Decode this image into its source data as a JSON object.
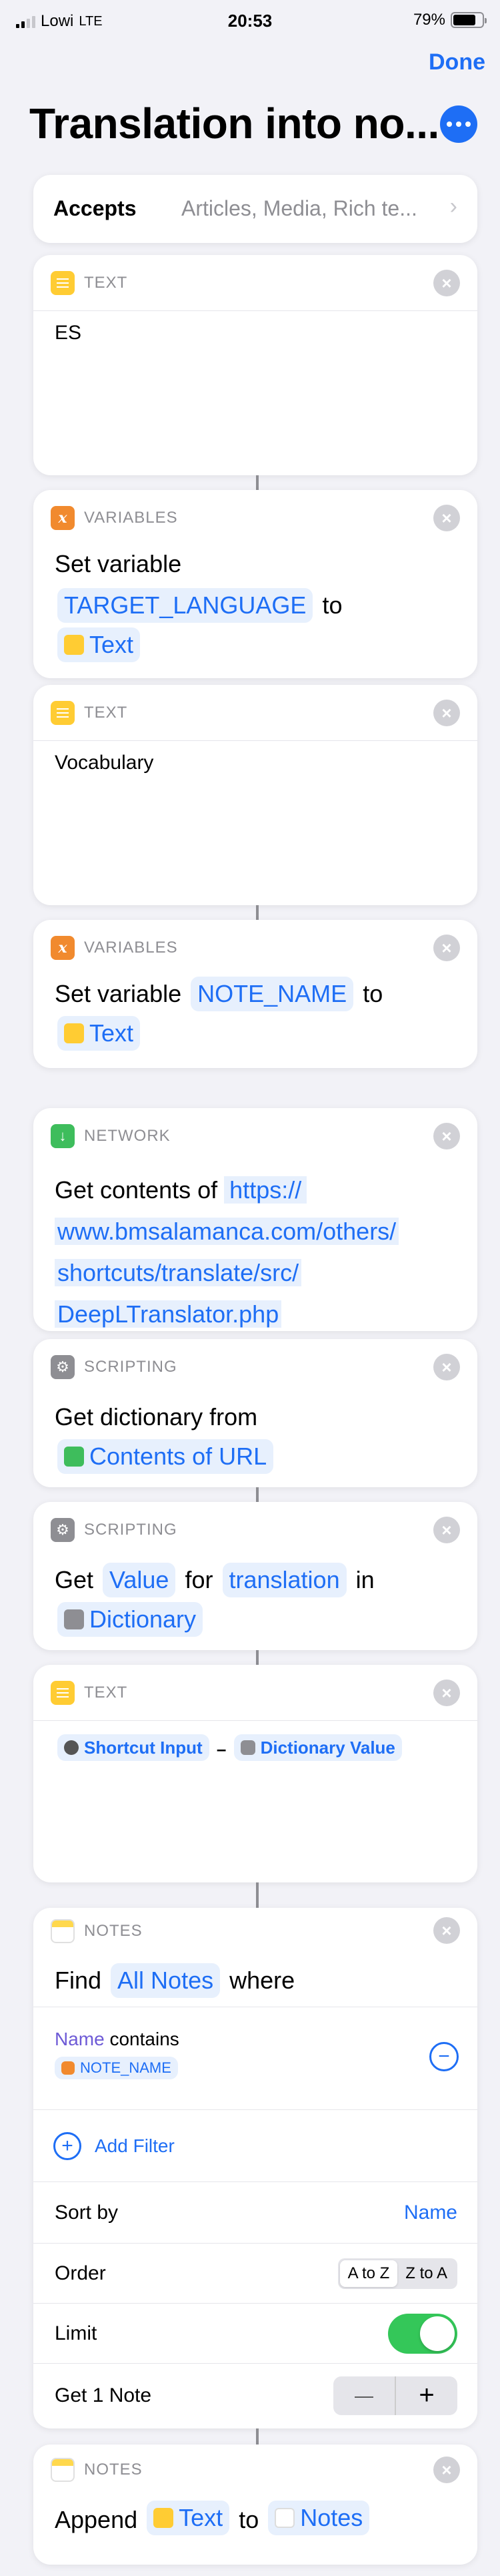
{
  "status": {
    "carrier": "Lowi",
    "network": "LTE",
    "time": "20:53",
    "battery": "79%",
    "battery_level": 0.79
  },
  "header": {
    "done_label": "Done",
    "title": "Translation into no..."
  },
  "accepts": {
    "label": "Accepts",
    "value": "Articles, Media, Rich te..."
  },
  "actions": [
    {
      "category": "TEXT",
      "text": "ES"
    },
    {
      "category": "VARIABLES",
      "prefix": "Set variable",
      "var_name": "TARGET_LANGUAGE",
      "to": "to",
      "value": "Text"
    },
    {
      "category": "TEXT",
      "text": "Vocabulary"
    },
    {
      "category": "VARIABLES",
      "prefix": "Set variable",
      "var_name": "NOTE_NAME",
      "to": "to",
      "value": "Text"
    },
    {
      "category": "NETWORK",
      "prefix": "Get contents of",
      "url_lines": [
        "https://",
        "www.bmsalamanca.com/others/",
        "shortcuts/translate/src/",
        "DeepLTranslator.php"
      ]
    },
    {
      "category": "SCRIPTING",
      "prefix": "Get dictionary from",
      "input": "Contents of URL"
    },
    {
      "category": "SCRIPTING",
      "get": "Get",
      "value_token": "Value",
      "for": "for",
      "key_token": "translation",
      "in": "in",
      "dict_token": "Dictionary"
    },
    {
      "category": "TEXT",
      "token1": "Shortcut Input",
      "dash": "–",
      "token2": "Dictionary Value"
    },
    {
      "category": "NOTES",
      "find": "Find",
      "all_notes": "All Notes",
      "where": "where",
      "filter_field": "Name",
      "filter_op": "contains",
      "filter_value": "NOTE_NAME",
      "add_filter": "Add Filter",
      "sort_label": "Sort by",
      "sort_value": "Name",
      "order_label": "Order",
      "order_options": [
        "A to Z",
        "Z to A"
      ],
      "order_selected": "A to Z",
      "limit_label": "Limit",
      "limit_on": true,
      "get_label": "Get 1 Note",
      "minus": "—",
      "plus": "+"
    },
    {
      "category": "NOTES",
      "prefix": "Append",
      "token": "Text",
      "to": "to",
      "target": "Notes"
    }
  ]
}
